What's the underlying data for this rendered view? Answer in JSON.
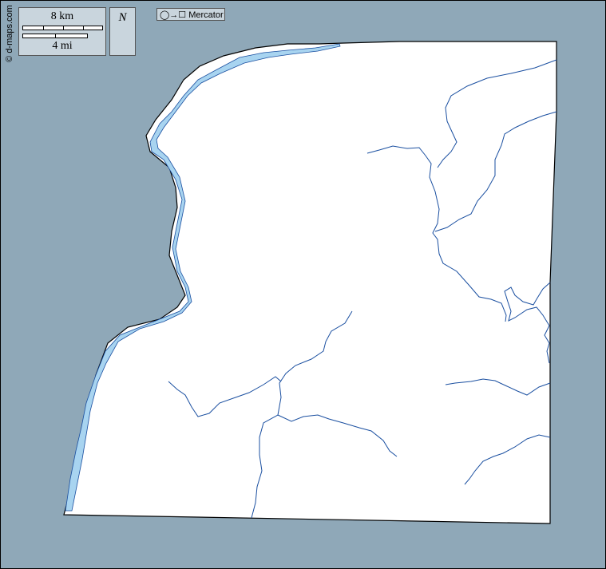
{
  "credit": "© d-maps.com",
  "scale": {
    "km_label": "8 km",
    "mi_label": "4 mi"
  },
  "north": {
    "label": "N"
  },
  "projection": {
    "symbol": "◯→☐",
    "label": "Mercator"
  },
  "colors": {
    "sea": "#8fa8b8",
    "land": "#ffffff",
    "water": "#a8d4f0",
    "river": "#1a4fa0",
    "panel": "#c9d5dd"
  },
  "icons": [
    "compass-rose-icon",
    "projection-icon"
  ]
}
